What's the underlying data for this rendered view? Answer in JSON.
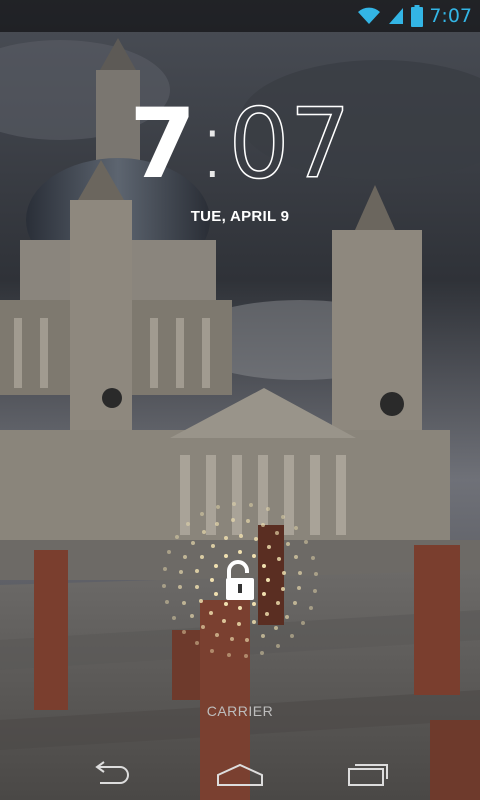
{
  "status_bar": {
    "time": "7:07",
    "icons": [
      "wifi-icon",
      "signal-icon",
      "battery-icon"
    ],
    "accent_color": "#33b5e5"
  },
  "lockscreen": {
    "clock_hour": "7",
    "clock_separator": ":",
    "clock_minutes": "07",
    "date": "TUE, APRIL 9",
    "carrier": "CARRIER",
    "unlock_icon": "unlock-padlock-icon"
  },
  "navigation": {
    "buttons": [
      "back-icon",
      "home-icon",
      "recent-apps-icon"
    ]
  }
}
